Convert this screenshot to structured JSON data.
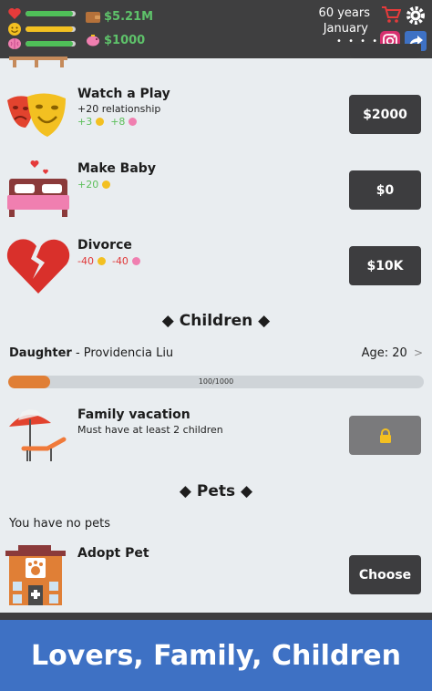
{
  "header": {
    "money": "$5.21M",
    "savings": "$1000",
    "age": "60 years",
    "month": "January",
    "dots": "• • • •",
    "bars": {
      "health": 0.95,
      "happiness": 0.95,
      "smarts": 0.95
    },
    "colors": {
      "health": "#4fbf58",
      "happiness": "#f3c021",
      "smarts": "#4fbf58"
    }
  },
  "activities": [
    {
      "title": "Watch a Play",
      "subtitle": "+20 relationship",
      "effects": [
        {
          "text": "+3",
          "kind": "pos",
          "icon": "happiness-icon"
        },
        {
          "text": "+8",
          "kind": "pos",
          "icon": "smarts-icon"
        }
      ],
      "button": "$2000"
    },
    {
      "title": "Make Baby",
      "subtitle": "",
      "effects": [
        {
          "text": "+20",
          "kind": "pos",
          "icon": "happiness-icon"
        }
      ],
      "button": "$0"
    },
    {
      "title": "Divorce",
      "subtitle": "",
      "effects": [
        {
          "text": "-40",
          "kind": "neg",
          "icon": "happiness-icon"
        },
        {
          "text": "-40",
          "kind": "neg",
          "icon": "smarts-icon"
        }
      ],
      "button": "$10K"
    }
  ],
  "children_section": {
    "heading": "◆ Children ◆",
    "child": {
      "relation": "Daughter",
      "separator": " - ",
      "name": "Providencia Liu",
      "age": "Age: 20",
      "chevron": ">"
    },
    "progress": {
      "value": 100,
      "max": 1000,
      "label": "100/1000"
    },
    "vacation": {
      "title": "Family vacation",
      "subtitle": "Must have at least 2 children",
      "button_icon": "lock-icon"
    }
  },
  "pets_section": {
    "heading": "◆ Pets ◆",
    "empty_text": "You have no pets",
    "adopt": {
      "title": "Adopt Pet",
      "button": "Choose"
    }
  },
  "banner": {
    "text": "Lovers, Family, Children"
  }
}
